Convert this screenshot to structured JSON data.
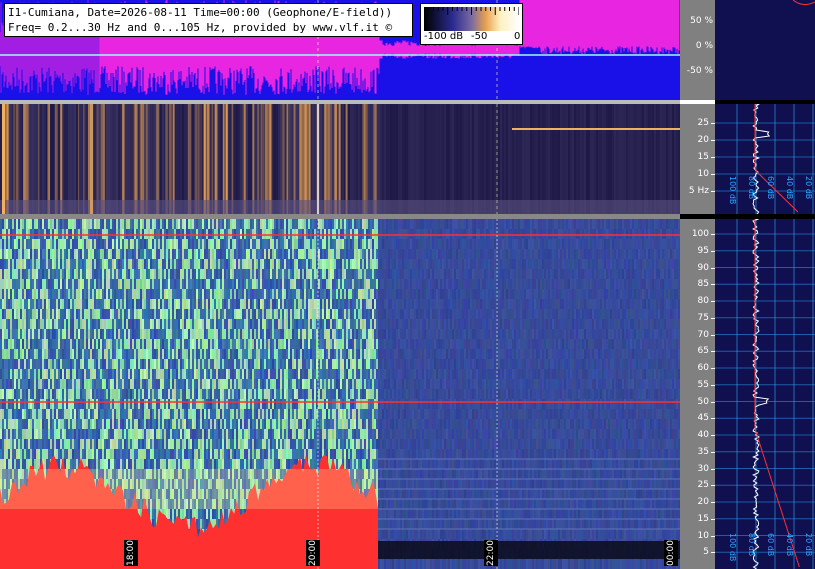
{
  "header": {
    "line1": "I1-Cumiana, Date=2026-08-11 Time=00:00 (Geophone/E-field))",
    "line2": "Freq= 0.2...30 Hz and 0...105 Hz, provided by www.vlf.it ©"
  },
  "colorbar": {
    "label_low": "-100 dB",
    "label_mid": "-50",
    "label_high": "0"
  },
  "waveform_scale": {
    "labels": [
      "50 %",
      "0 %",
      "-50 %"
    ]
  },
  "spectrogram_low": {
    "freq_labels": [
      "25",
      "20",
      "15",
      "10",
      "5 Hz"
    ]
  },
  "spectrogram_high": {
    "freq_labels": [
      "100",
      "95",
      "90",
      "85",
      "80",
      "75",
      "70",
      "65",
      "60",
      "55",
      "50",
      "45",
      "40",
      "35",
      "30",
      "25",
      "20",
      "15",
      "10",
      "5"
    ]
  },
  "time_axis": {
    "labels": [
      "18:00",
      "20:00",
      "22:00",
      "00:00"
    ]
  },
  "profile_low": {
    "labels": [
      "100 dB",
      "80 dB",
      "60 dB",
      "40 dB",
      "20 dB"
    ]
  },
  "profile_high": {
    "labels": [
      "100 dB",
      "80 dB",
      "60 dB",
      "40 dB",
      "20 dB"
    ]
  },
  "colors": {
    "waveform_bg": "#1a10e8",
    "waveform_trace": "#ff28e0",
    "accent_line": "#ff3030",
    "profile_bg": "#101050",
    "grid": "#2aa8ff"
  }
}
